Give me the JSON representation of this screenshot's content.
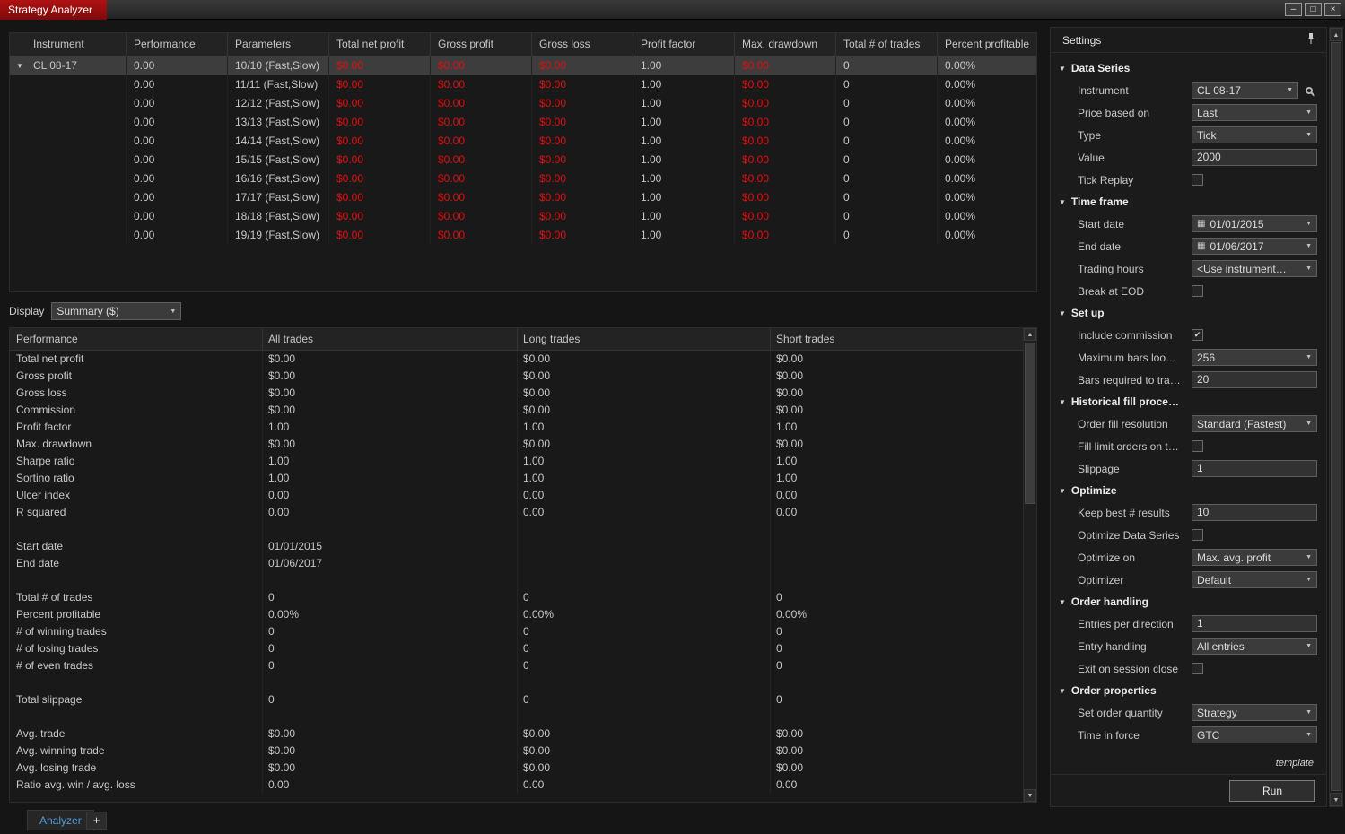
{
  "window": {
    "title": "Strategy Analyzer"
  },
  "icons": {
    "minimize": "–",
    "maximize": "□",
    "close": "×",
    "section_collapse": "▼",
    "dropdown_arrow": "▼",
    "scroll_up": "▲",
    "scroll_down": "▼",
    "calendar": "▦",
    "check": "✔",
    "expand_row": "▼"
  },
  "colors": {
    "loss_red": "#e01010",
    "title_tab_red": "#b01212",
    "active_tab_blue": "#569cd6"
  },
  "results": {
    "columns": [
      "Instrument",
      "Performance",
      "Parameters",
      "Total net profit",
      "Gross profit",
      "Gross loss",
      "Profit factor",
      "Max. drawdown",
      "Total # of trades",
      "Percent profitable"
    ],
    "red_columns": [
      3,
      4,
      5,
      7
    ],
    "rows": [
      [
        "CL 08-17",
        "0.00",
        "10/10 (Fast,Slow)",
        "$0.00",
        "$0.00",
        "$0.00",
        "1.00",
        "$0.00",
        "0",
        "0.00%"
      ],
      [
        "",
        "0.00",
        "11/11 (Fast,Slow)",
        "$0.00",
        "$0.00",
        "$0.00",
        "1.00",
        "$0.00",
        "0",
        "0.00%"
      ],
      [
        "",
        "0.00",
        "12/12 (Fast,Slow)",
        "$0.00",
        "$0.00",
        "$0.00",
        "1.00",
        "$0.00",
        "0",
        "0.00%"
      ],
      [
        "",
        "0.00",
        "13/13 (Fast,Slow)",
        "$0.00",
        "$0.00",
        "$0.00",
        "1.00",
        "$0.00",
        "0",
        "0.00%"
      ],
      [
        "",
        "0.00",
        "14/14 (Fast,Slow)",
        "$0.00",
        "$0.00",
        "$0.00",
        "1.00",
        "$0.00",
        "0",
        "0.00%"
      ],
      [
        "",
        "0.00",
        "15/15 (Fast,Slow)",
        "$0.00",
        "$0.00",
        "$0.00",
        "1.00",
        "$0.00",
        "0",
        "0.00%"
      ],
      [
        "",
        "0.00",
        "16/16 (Fast,Slow)",
        "$0.00",
        "$0.00",
        "$0.00",
        "1.00",
        "$0.00",
        "0",
        "0.00%"
      ],
      [
        "",
        "0.00",
        "17/17 (Fast,Slow)",
        "$0.00",
        "$0.00",
        "$0.00",
        "1.00",
        "$0.00",
        "0",
        "0.00%"
      ],
      [
        "",
        "0.00",
        "18/18 (Fast,Slow)",
        "$0.00",
        "$0.00",
        "$0.00",
        "1.00",
        "$0.00",
        "0",
        "0.00%"
      ],
      [
        "",
        "0.00",
        "19/19 (Fast,Slow)",
        "$0.00",
        "$0.00",
        "$0.00",
        "1.00",
        "$0.00",
        "0",
        "0.00%"
      ]
    ]
  },
  "display": {
    "label": "Display",
    "value": "Summary ($)"
  },
  "summary": {
    "columns": [
      "Performance",
      "All trades",
      "Long trades",
      "Short trades"
    ],
    "rows": [
      [
        "Total net profit",
        "$0.00",
        "$0.00",
        "$0.00"
      ],
      [
        "Gross profit",
        "$0.00",
        "$0.00",
        "$0.00"
      ],
      [
        "Gross loss",
        "$0.00",
        "$0.00",
        "$0.00"
      ],
      [
        "Commission",
        "$0.00",
        "$0.00",
        "$0.00"
      ],
      [
        "Profit factor",
        "1.00",
        "1.00",
        "1.00"
      ],
      [
        "Max. drawdown",
        "$0.00",
        "$0.00",
        "$0.00"
      ],
      [
        "Sharpe ratio",
        "1.00",
        "1.00",
        "1.00"
      ],
      [
        "Sortino ratio",
        "1.00",
        "1.00",
        "1.00"
      ],
      [
        "Ulcer index",
        "0.00",
        "0.00",
        "0.00"
      ],
      [
        "R squared",
        "0.00",
        "0.00",
        "0.00"
      ],
      [
        "",
        "",
        "",
        ""
      ],
      [
        "Start date",
        "01/01/2015",
        "",
        ""
      ],
      [
        "End date",
        "01/06/2017",
        "",
        ""
      ],
      [
        "",
        "",
        "",
        ""
      ],
      [
        "Total # of trades",
        "0",
        "0",
        "0"
      ],
      [
        "Percent profitable",
        "0.00%",
        "0.00%",
        "0.00%"
      ],
      [
        "# of winning trades",
        "0",
        "0",
        "0"
      ],
      [
        "# of losing trades",
        "0",
        "0",
        "0"
      ],
      [
        "# of even trades",
        "0",
        "0",
        "0"
      ],
      [
        "",
        "",
        "",
        ""
      ],
      [
        "Total slippage",
        "0",
        "0",
        "0"
      ],
      [
        "",
        "",
        "",
        ""
      ],
      [
        "Avg. trade",
        "$0.00",
        "$0.00",
        "$0.00"
      ],
      [
        "Avg. winning trade",
        "$0.00",
        "$0.00",
        "$0.00"
      ],
      [
        "Avg. losing trade",
        "$0.00",
        "$0.00",
        "$0.00"
      ],
      [
        "Ratio avg. win / avg. loss",
        "0.00",
        "0.00",
        "0.00"
      ]
    ]
  },
  "settings": {
    "title": "Settings",
    "template_label": "template",
    "run_label": "Run",
    "sections": [
      {
        "title": "Data Series",
        "fields": [
          {
            "label": "Instrument",
            "value": "CL 08-17",
            "control": "select-search"
          },
          {
            "label": "Price based on",
            "value": "Last",
            "control": "select"
          },
          {
            "label": "Type",
            "value": "Tick",
            "control": "select"
          },
          {
            "label": "Value",
            "value": "2000",
            "control": "input"
          },
          {
            "label": "Tick Replay",
            "control": "checkbox",
            "checked": false
          }
        ]
      },
      {
        "title": "Time frame",
        "fields": [
          {
            "label": "Start date",
            "value": "01/01/2015",
            "control": "date"
          },
          {
            "label": "End date",
            "value": "01/06/2017",
            "control": "date"
          },
          {
            "label": "Trading hours",
            "value": "<Use instrument…",
            "control": "select"
          },
          {
            "label": "Break at EOD",
            "control": "checkbox",
            "checked": false
          }
        ]
      },
      {
        "title": "Set up",
        "fields": [
          {
            "label": "Include commission",
            "control": "checkbox",
            "checked": true
          },
          {
            "label": "Maximum bars loo…",
            "value": "256",
            "control": "select"
          },
          {
            "label": "Bars required to tra…",
            "value": "20",
            "control": "input"
          }
        ]
      },
      {
        "title": "Historical fill proce…",
        "fields": [
          {
            "label": "Order fill resolution",
            "value": "Standard (Fastest)",
            "control": "select"
          },
          {
            "label": "Fill limit orders on t…",
            "control": "checkbox",
            "checked": false
          },
          {
            "label": "Slippage",
            "value": "1",
            "control": "input"
          }
        ]
      },
      {
        "title": "Optimize",
        "fields": [
          {
            "label": "Keep best # results",
            "value": "10",
            "control": "input"
          },
          {
            "label": "Optimize Data Series",
            "control": "checkbox",
            "checked": false
          },
          {
            "label": "Optimize on",
            "value": "Max. avg. profit",
            "control": "select"
          },
          {
            "label": "Optimizer",
            "value": "Default",
            "control": "select"
          }
        ]
      },
      {
        "title": "Order handling",
        "fields": [
          {
            "label": "Entries per direction",
            "value": "1",
            "control": "input"
          },
          {
            "label": "Entry handling",
            "value": "All entries",
            "control": "select"
          },
          {
            "label": "Exit on session close",
            "control": "checkbox",
            "checked": false
          }
        ]
      },
      {
        "title": "Order properties",
        "fields": [
          {
            "label": "Set order quantity",
            "value": "Strategy",
            "control": "select"
          },
          {
            "label": "Time in force",
            "value": "GTC",
            "control": "select"
          }
        ]
      }
    ]
  },
  "tabs": {
    "active": "Analyzer",
    "add_label": "+"
  }
}
